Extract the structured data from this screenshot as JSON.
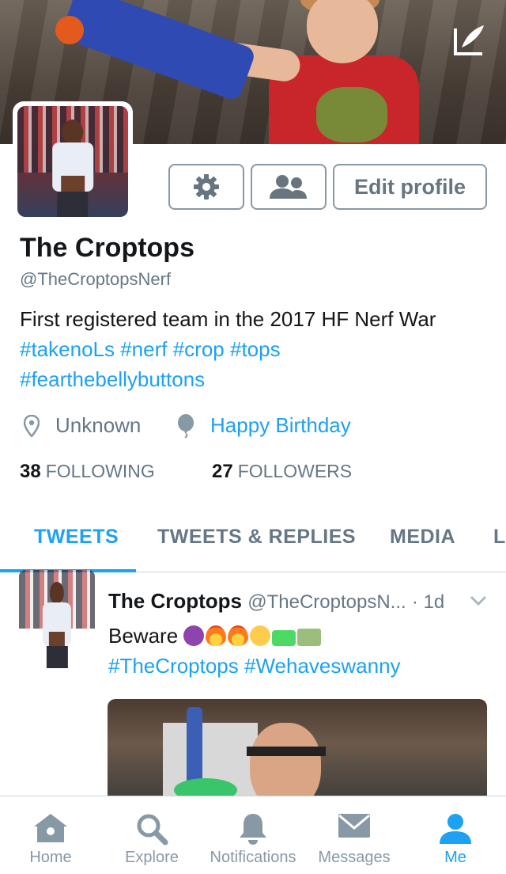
{
  "profile": {
    "name": "The Croptops",
    "handle": "@TheCroptopsNerf",
    "bio_text": "First registered team in the 2017 HF Nerf War",
    "bio_tags": [
      "#takenoLs",
      "#nerf",
      "#crop",
      "#tops",
      "#fearthebellybuttons"
    ],
    "location": "Unknown",
    "birthday": "Happy Birthday",
    "following_count": "38",
    "following_label": "FOLLOWING",
    "followers_count": "27",
    "followers_label": "FOLLOWERS",
    "edit_profile_label": "Edit profile"
  },
  "tabs": [
    "TWEETS",
    "TWEETS & REPLIES",
    "MEDIA",
    "L"
  ],
  "tweet": {
    "name": "The Croptops",
    "handle": "@TheCroptopsN...",
    "time": "· 1d",
    "text": "Beware",
    "tag1": "#TheCroptops",
    "tag2": "#Wehaveswanny"
  },
  "tabbar": {
    "home": "Home",
    "explore": "Explore",
    "notifications": "Notifications",
    "messages": "Messages",
    "me": "Me"
  },
  "colors": {
    "accent": "#1da1f2",
    "muted": "#657786",
    "text": "#14171a"
  }
}
